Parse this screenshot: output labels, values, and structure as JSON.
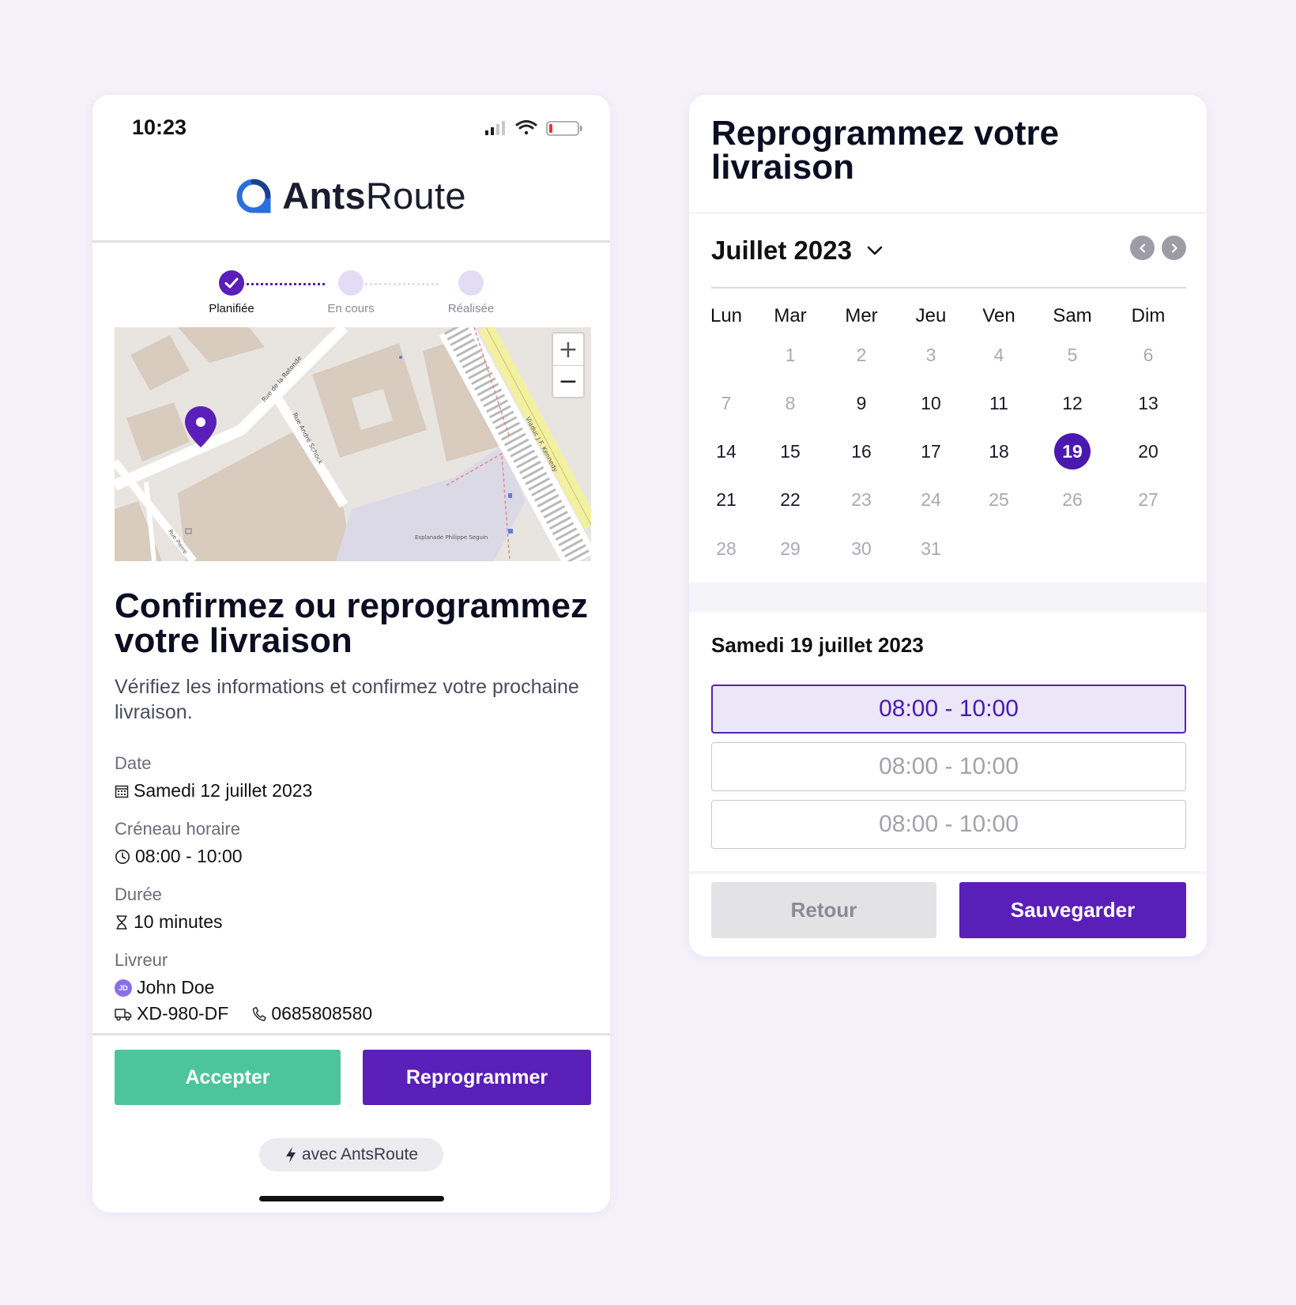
{
  "phone": {
    "status_time": "10:23",
    "logo": {
      "bold": "Ants",
      "light": "Route"
    },
    "steps": [
      {
        "label": "Planifiée",
        "state": "done"
      },
      {
        "label": "En cours",
        "state": "pending"
      },
      {
        "label": "Réalisée",
        "state": "pending"
      }
    ],
    "map": {
      "street_labels": [
        "Rue de la Rotonde",
        "Rue André Schock",
        "Viaduc J.F. Kennedy",
        "Rue Pierre",
        "Esplanade Philippe Seguin"
      ],
      "zoom_in": "+",
      "zoom_out": "−"
    },
    "headline": "Confirmez ou reprogrammez votre livraison",
    "subhead": "Vérifiez les informations et confirmez votre prochaine livraison.",
    "info": {
      "date_label": "Date",
      "date_value": "Samedi 12 juillet 2023",
      "slot_label": "Créneau horaire",
      "slot_value": "08:00 - 10:00",
      "duration_label": "Durée",
      "duration_value": "10 minutes",
      "driver_label": "Livreur",
      "driver_initials": "JD",
      "driver_name": "John Doe",
      "plate": "XD-980-DF",
      "phone": "0685808580"
    },
    "accept_label": "Accepter",
    "reschedule_label": "Reprogrammer",
    "powered_by": "avec AntsRoute"
  },
  "reschedule": {
    "title": "Reprogrammez votre livraison",
    "month": "Juillet 2023",
    "weekdays": [
      "Lun",
      "Mar",
      "Mer",
      "Jeu",
      "Ven",
      "Sam",
      "Dim"
    ],
    "first_weekday_index": 1,
    "days_in_month": 31,
    "available_days": [
      9,
      10,
      11,
      12,
      13,
      14,
      15,
      16,
      17,
      18,
      19,
      20,
      21,
      22
    ],
    "selected_day": 19,
    "selected_date_label": "Samedi 19 juillet 2023",
    "slots": [
      {
        "label": "08:00 - 10:00",
        "selected": true
      },
      {
        "label": "08:00 - 10:00",
        "selected": false
      },
      {
        "label": "08:00 - 10:00",
        "selected": false
      }
    ],
    "back_label": "Retour",
    "save_label": "Sauvegarder"
  },
  "colors": {
    "brand_purple": "#5a1fb8",
    "accept_green": "#4cc49c",
    "background": "#f4f1fb",
    "step_pending": "#e3dcf5"
  }
}
